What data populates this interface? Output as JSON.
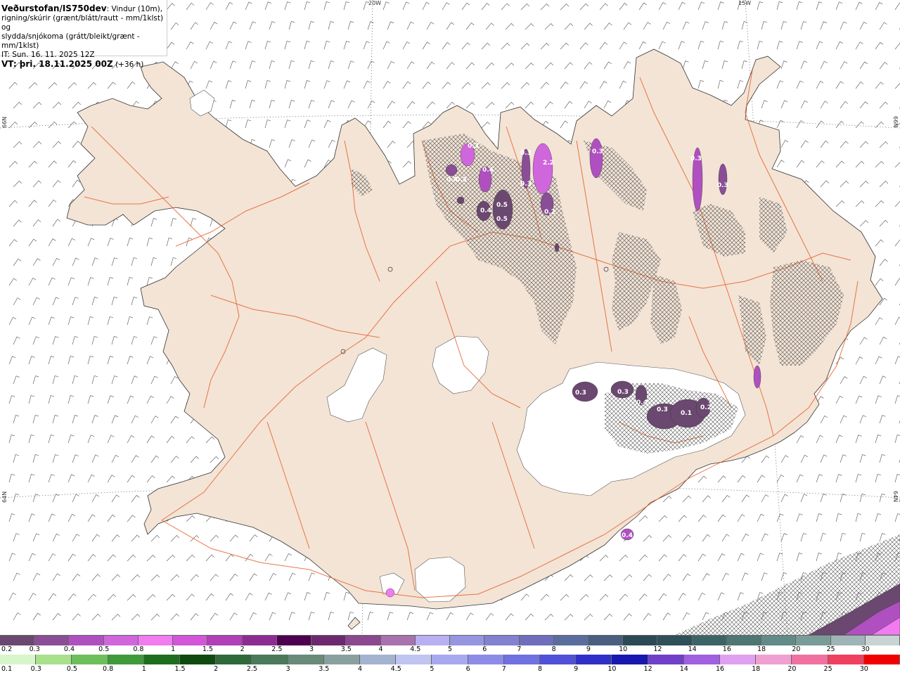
{
  "header": {
    "source": "Veðurstofan/IS750dev",
    "description_1": ": Vindur (10m),",
    "description_2": "rigning/skúrir (grænt/blátt/rautt - mm/1klst) og",
    "description_3": "slydda/snjókoma (grátt/bleikt/grænt - mm/1klst)",
    "issue_time": "IT: Sun. 16. 11. 2025 12Z",
    "valid_time_label": "VT: þri. 18.11.2025 00Z",
    "valid_time_offset": "(+36 h)"
  },
  "grid_labels": {
    "top_20w": "20W",
    "top_15w": "15W",
    "left_66n": "66N",
    "right_66n": "66N",
    "left_64n": "64N",
    "right_64n": "64N"
  },
  "precip_labels": [
    "0.3",
    "0.4",
    "2.2",
    "0.3",
    "0.5",
    "0.4",
    "0.5",
    "0.2",
    "0.3",
    "0.4",
    "0.3",
    "0.3",
    "0.3",
    "0.3",
    "0.4",
    "0.3",
    "0.1",
    "0.2",
    "0.4",
    "0.3",
    "0.3"
  ],
  "legend_snow": {
    "labels": [
      "0.2",
      "0.3",
      "0.4",
      "0.5",
      "0.8",
      "1",
      "1.5",
      "2",
      "2.5",
      "3",
      "3.5",
      "4",
      "4.5",
      "5",
      "6",
      "7",
      "8",
      "9",
      "10",
      "12",
      "14",
      "16",
      "18",
      "20",
      "25",
      "30"
    ],
    "colors": [
      "#6b4870",
      "#8a4e96",
      "#b050c0",
      "#d066dc",
      "#f07cf0",
      "#d356d8",
      "#b13fb8",
      "#8e2b93",
      "#4d004f",
      "#6c2a6e",
      "#8a488f",
      "#a872ad",
      "#b8b0f0",
      "#9696e0",
      "#8282d0",
      "#6e6ebc",
      "#5a6e9e",
      "#4a5e80",
      "#2c4a56",
      "#2f5058",
      "#3c6466",
      "#4e7672",
      "#628a86",
      "#7a9c98",
      "#9fb4b6",
      "#c8d4d4"
    ]
  },
  "legend_rain": {
    "labels": [
      "0.1",
      "0.3",
      "0.5",
      "0.8",
      "1",
      "1.5",
      "2",
      "2.5",
      "3",
      "3.5",
      "4",
      "4.5",
      "5",
      "6",
      "7",
      "8",
      "9",
      "10",
      "12",
      "14",
      "16",
      "18",
      "20",
      "25",
      "30"
    ],
    "colors": [
      "#d8f5cc",
      "#a8e08c",
      "#6cbf5a",
      "#3f9a3a",
      "#1f6e1f",
      "#0f4a10",
      "#2e6a3a",
      "#4a7a5a",
      "#6a8a7a",
      "#8aa0a0",
      "#a4b4d0",
      "#c0c4f0",
      "#a8a8f0",
      "#8c8ce8",
      "#7070e0",
      "#5050d8",
      "#3030c8",
      "#1818b0",
      "#7040c8",
      "#a060e0",
      "#e0a0f0",
      "#f0a0d0",
      "#f070a0",
      "#f04060",
      "#f00000"
    ]
  }
}
